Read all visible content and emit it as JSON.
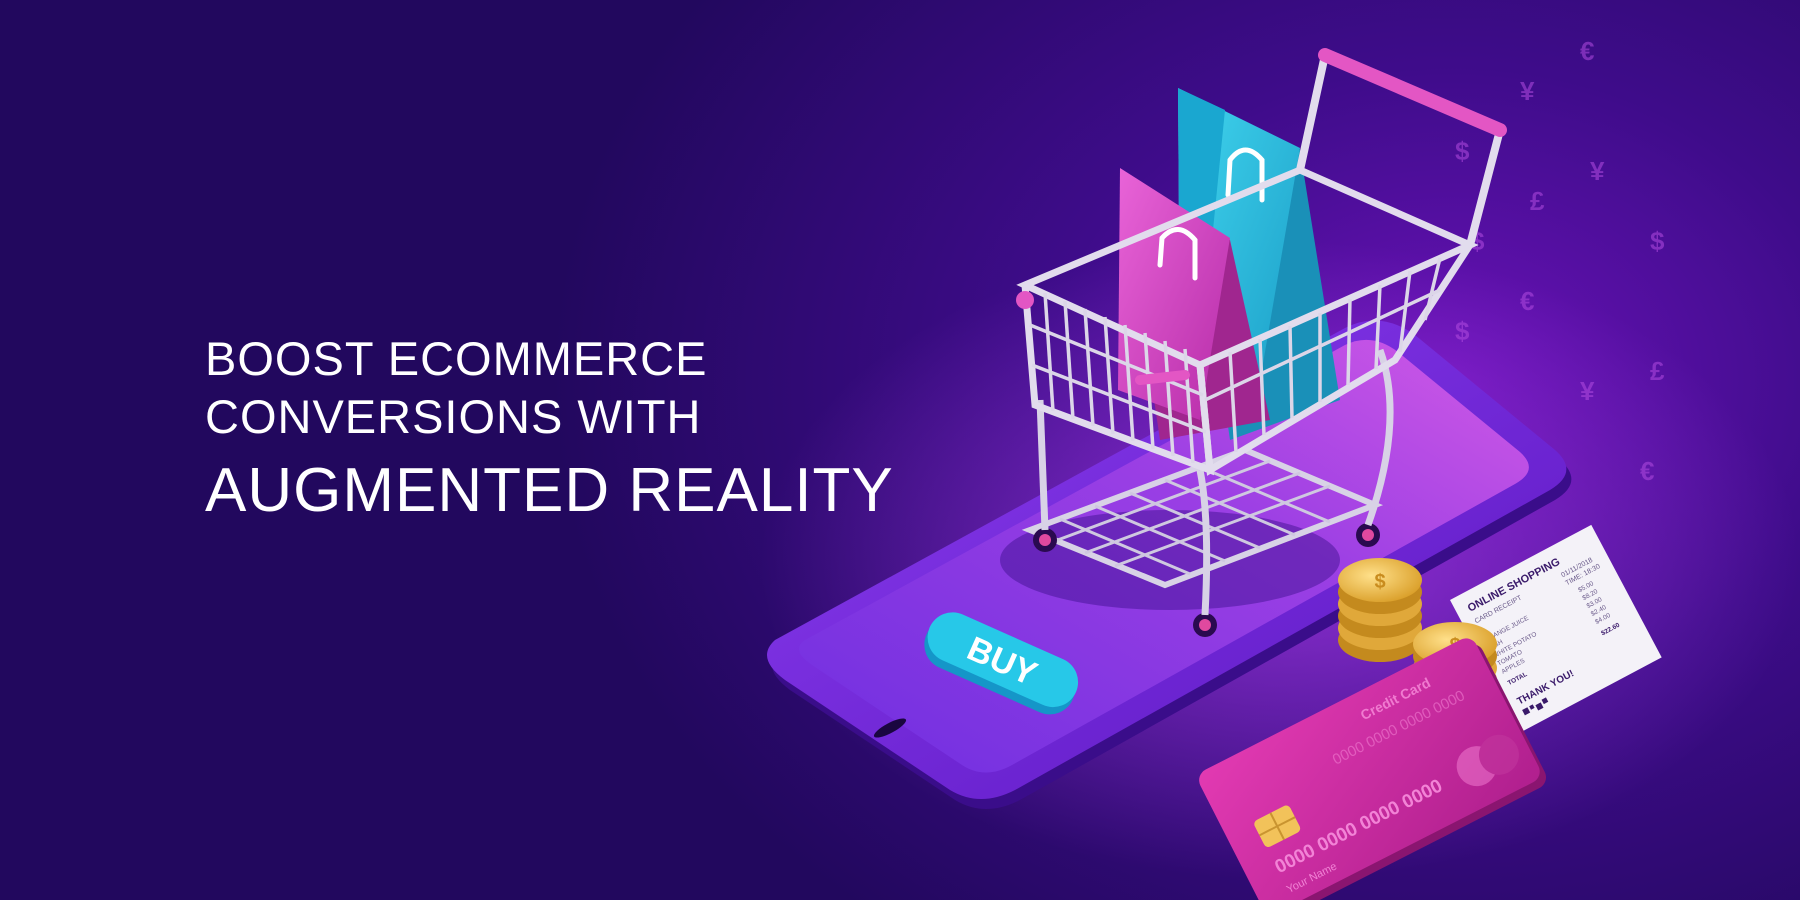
{
  "headline": {
    "line1": "BOOST ECOMMERCE",
    "line2": "CONVERSIONS WITH",
    "line3": "AUGMENTED REALITY"
  },
  "phone": {
    "buy_label": "BUY"
  },
  "receipt": {
    "title": "ONLINE SHOPPING",
    "subtitle": "CARD RECEIPT",
    "date": "01/11/2018",
    "time": "TIME: 18:30",
    "items": [
      {
        "name": "ORANGE JUICE",
        "price": "$5.00"
      },
      {
        "name": "FISH",
        "price": "$8.20"
      },
      {
        "name": "WHITE POTATO",
        "price": "$3.00"
      },
      {
        "name": "TOMATO",
        "price": "$2.40"
      },
      {
        "name": "APPLES",
        "price": "$4.00"
      }
    ],
    "total_label": "TOTAL",
    "total_value": "$22.60",
    "thank_you": "THANK YOU!"
  },
  "credit_card": {
    "title": "Credit Card",
    "number_top": "0000 0000 0000 0000",
    "number": "0000 0000 0000 0000",
    "holder": "Your Name"
  },
  "currency_symbols": [
    "$",
    "¥",
    "€",
    "$",
    "£",
    "¥",
    "$",
    "€",
    "$",
    "¥",
    "£",
    "€"
  ],
  "colors": {
    "background": "#2a0a6e",
    "bag_pink": "#d548c6",
    "bag_cyan": "#2cc3e0",
    "buy_button": "#27c8e8",
    "card": "#d0309f",
    "coin": "#f3c24a"
  },
  "icons": [
    "shopping-cart-icon",
    "shopping-bag-icon",
    "coin-icon",
    "card-chip-icon",
    "card-logo-icon"
  ]
}
